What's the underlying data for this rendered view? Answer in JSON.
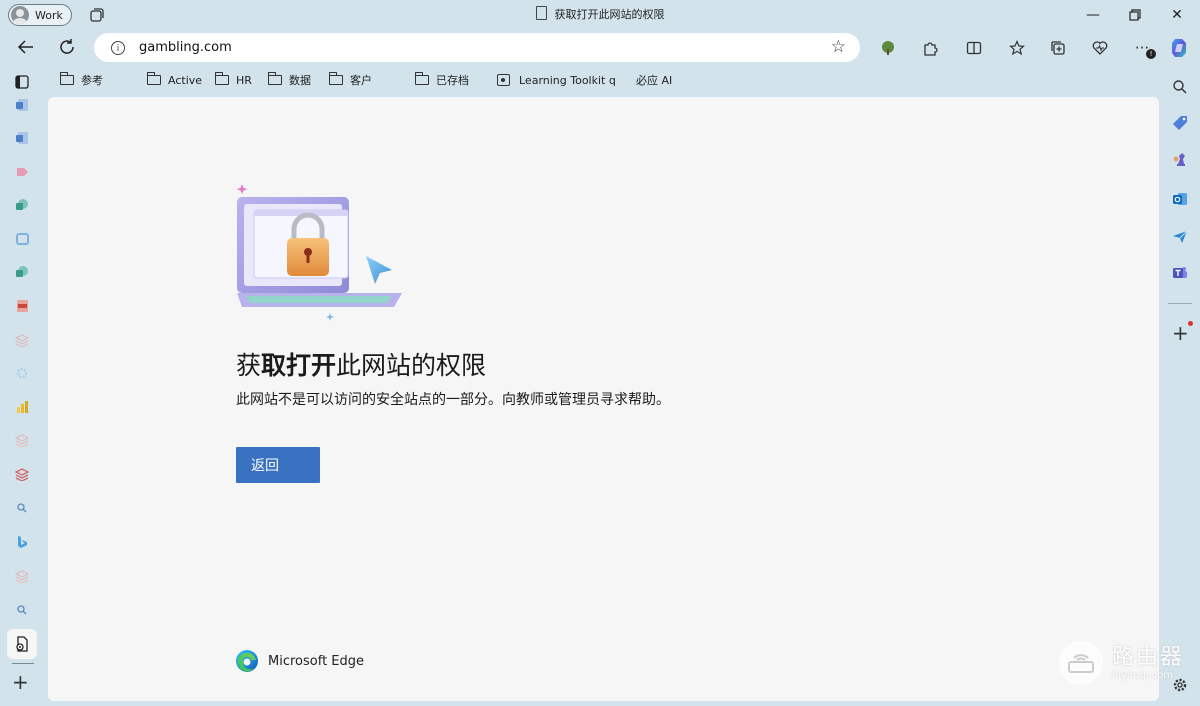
{
  "window": {
    "title": "获取打开此网站的权限",
    "profile_label": "Work"
  },
  "address_bar": {
    "url": "gambling.com"
  },
  "bookmarks": [
    {
      "label": "参考",
      "type": "folder"
    },
    {
      "label": "Active",
      "type": "folder"
    },
    {
      "label": "HR",
      "type": "folder"
    },
    {
      "label": "数据",
      "type": "folder"
    },
    {
      "label": "客户",
      "type": "folder"
    },
    {
      "label": "已存档",
      "type": "folder"
    },
    {
      "label": "Learning Toolkit q",
      "type": "link"
    },
    {
      "label": "必应 AI",
      "type": "link"
    }
  ],
  "page": {
    "heading_light": "获",
    "heading_bold": "取打开",
    "heading_rest": "此网站的权限",
    "message": "此网站不是可以访问的安全站点的一部分。向教师或管理员寻求帮助。",
    "back_button": "返回",
    "brand": "Microsoft Edge"
  },
  "watermark": {
    "text": "路由器",
    "subtext": "luyouqi.com"
  },
  "icons": {
    "left_sidebar": [
      "sidebar-toggle-icon",
      "word-icon",
      "word-icon",
      "pink-arrow-icon",
      "sharepoint-icon",
      "outlook-icon",
      "sharepoint-icon",
      "pdf-icon",
      "stack-icon",
      "gear-icon",
      "powerbi-icon",
      "stack-icon",
      "stack-icon",
      "search-icon",
      "bing-icon",
      "stack-icon",
      "search-icon",
      "page-settings-icon",
      "add-icon"
    ],
    "right_sidebar": [
      "search-icon",
      "tag-icon",
      "chess-icon",
      "outlook-icon",
      "send-icon",
      "teams-icon",
      "add-icon",
      "settings-icon"
    ]
  },
  "colors": {
    "chrome_bg": "#d3e3ec",
    "content_bg": "#f6f6f6",
    "button_blue": "#3a72c2"
  }
}
